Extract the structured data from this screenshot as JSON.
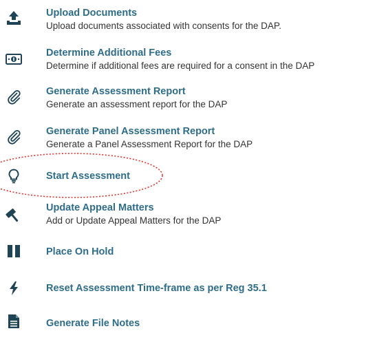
{
  "actions": [
    {
      "title": "Upload Documents",
      "description": "Upload documents associated with consents for the DAP.",
      "icon": "upload-icon"
    },
    {
      "title": "Determine Additional Fees",
      "description": "Determine if additional fees are required for a consent in the DAP",
      "icon": "money-icon"
    },
    {
      "title": "Generate Assessment Report",
      "description": "Generate an assessment report for the DAP",
      "icon": "paperclip-icon"
    },
    {
      "title": "Generate Panel Assessment Report",
      "description": "Generate a Panel Assessment Report for the DAP",
      "icon": "paperclip-icon"
    },
    {
      "title": "Start Assessment",
      "icon": "lightbulb-icon"
    },
    {
      "title": "Update Appeal Matters",
      "description": "Add or Update Appeal Matters for the DAP",
      "icon": "gavel-icon"
    },
    {
      "title": "Place On Hold",
      "icon": "pause-icon"
    },
    {
      "title": "Reset Assessment Time-frame as per Reg 35.1",
      "icon": "bolt-icon"
    },
    {
      "title": "Generate File Notes",
      "icon": "document-icon"
    }
  ],
  "colors": {
    "title": "#2e6d8a",
    "icon": "#1f4455",
    "description": "#333333",
    "highlight": "#e0322b"
  }
}
